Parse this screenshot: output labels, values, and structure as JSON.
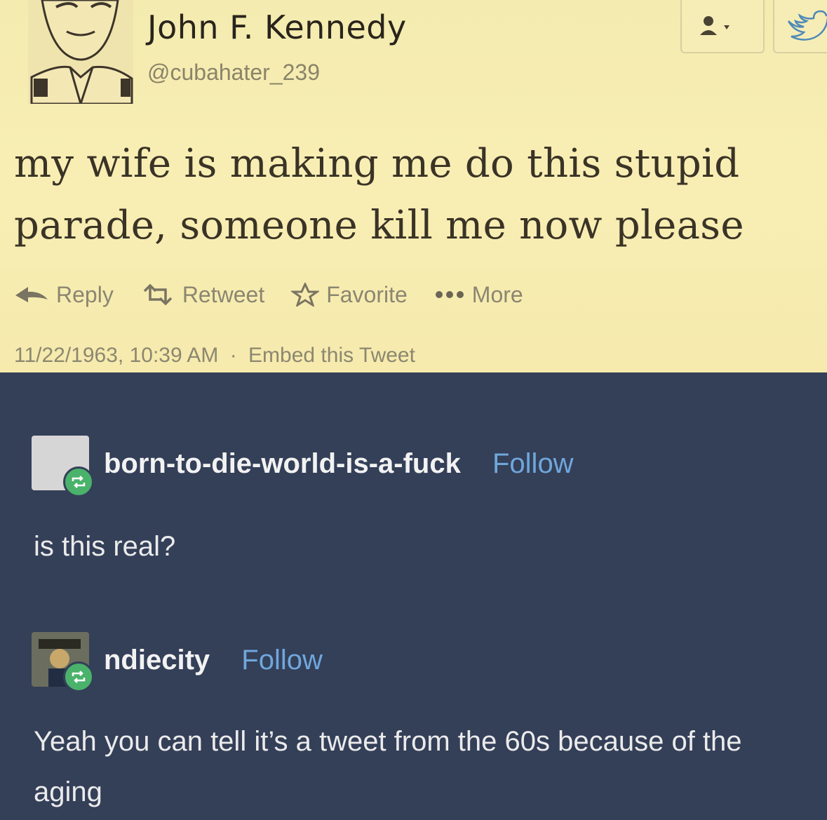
{
  "tweet": {
    "display_name": "John F. Kennedy",
    "handle": "@cubahater_239",
    "text": "my wife is making me do this stupid parade, someone kill me now please",
    "actions": {
      "reply": "Reply",
      "retweet": "Retweet",
      "favorite": "Favorite",
      "more": "More"
    },
    "timestamp": "11/22/1963, 10:39 AM",
    "separator": "·",
    "embed": "Embed this Tweet"
  },
  "reblogs": [
    {
      "username": "born-to-die-world-is-a-fuck",
      "follow": "Follow",
      "comment": "is this real?"
    },
    {
      "username": "ndiecity",
      "follow": "Follow",
      "comment": "Yeah you can tell it’s a tweet from the 60s because of the aging"
    }
  ],
  "colors": {
    "tweet_background": "#f6ecb1",
    "dashboard_background": "#343f58",
    "follow_link": "#6fa7dc",
    "reblog_badge": "#4ab26b"
  }
}
